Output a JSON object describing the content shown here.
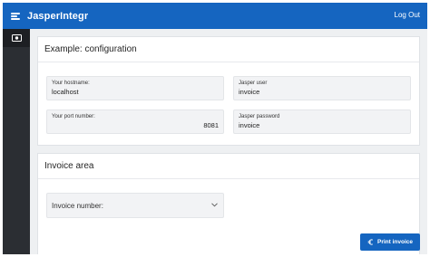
{
  "header": {
    "app_title": "JasperIntegr",
    "logout_label": "Log Out"
  },
  "sidebar": {
    "items": [
      {
        "icon": "money-icon"
      }
    ]
  },
  "config_card": {
    "title": "Example: configuration",
    "hostname": {
      "label": "Your hostname:",
      "value": "localhost"
    },
    "port": {
      "label": "Your port number:",
      "value": "8081"
    },
    "user": {
      "label": "Jasper user",
      "value": "invoice"
    },
    "password": {
      "label": "Jasper password",
      "value": "invoice"
    }
  },
  "invoice_card": {
    "title": "Invoice area",
    "invoice_select_label": "Invoice number:",
    "print_button_label": "Print invoice"
  },
  "colors": {
    "primary": "#1565c0",
    "sidebar": "#2b2e33",
    "background": "#eef0f2"
  }
}
